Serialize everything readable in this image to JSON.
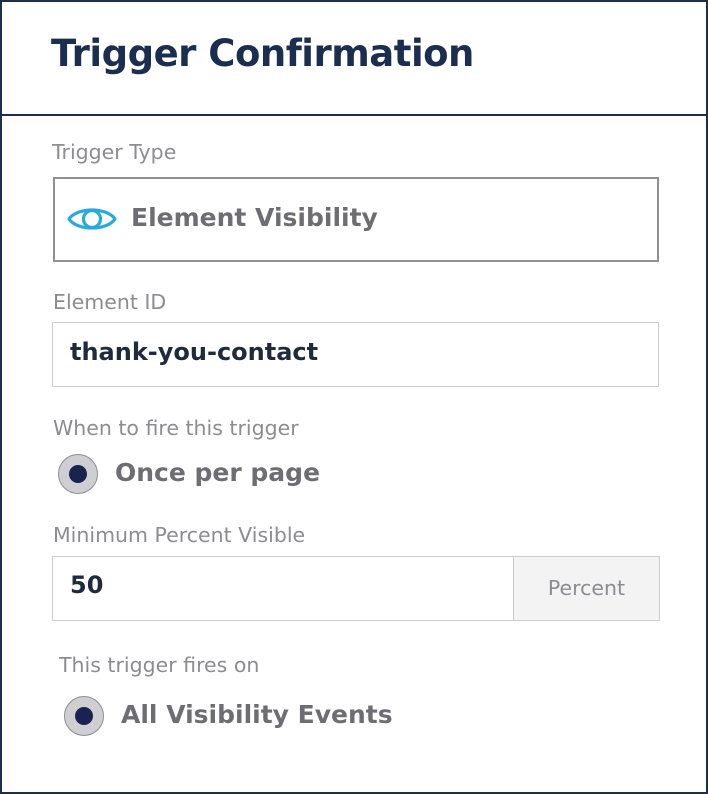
{
  "panel": {
    "title": "Trigger Confirmation"
  },
  "trigger_type": {
    "label": "Trigger Type",
    "icon": "eye-icon",
    "value": "Element Visibility",
    "icon_color": "#29a9e1"
  },
  "element_id": {
    "label": "Element ID",
    "value": "thank-you-contact"
  },
  "fire_frequency": {
    "label": "When to fire this trigger",
    "selected_option": "Once per page"
  },
  "min_percent_visible": {
    "label": "Minimum Percent Visible",
    "value": "50",
    "unit": "Percent"
  },
  "fires_on": {
    "label": "This trigger fires on",
    "selected_option": "All Visibility Events"
  },
  "colors": {
    "title": "#1c2e4f",
    "radio_dot": "#1a2350",
    "muted_text": "#8c8c92"
  }
}
